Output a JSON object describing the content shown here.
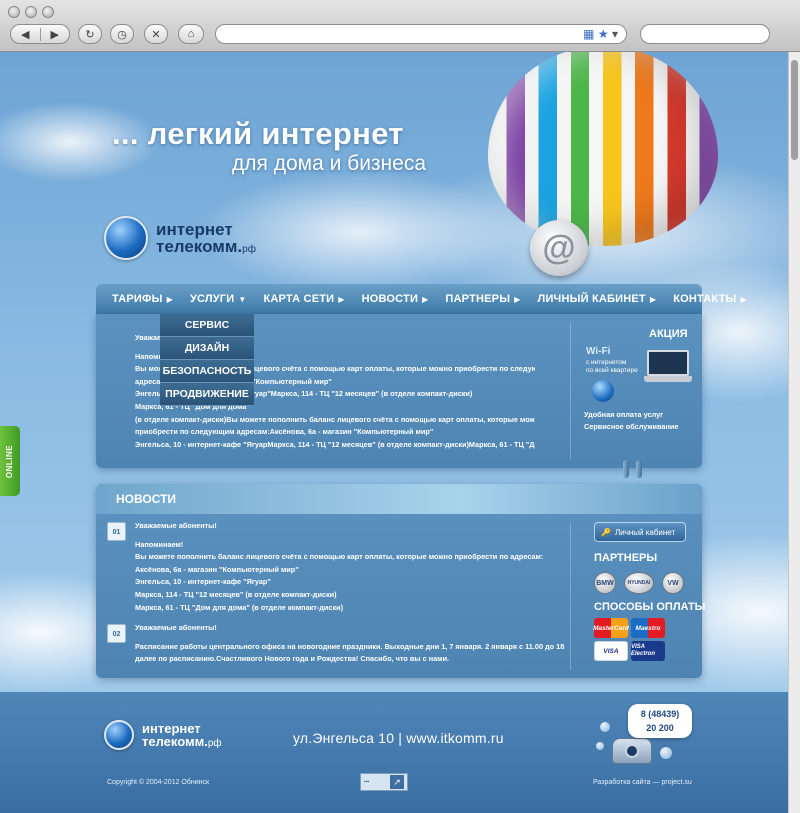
{
  "browser": {
    "back_label": "◀",
    "forward_label": "▶",
    "reload_icon": "reload-icon",
    "history_icon": "clock-icon",
    "stop_icon": "close-icon",
    "home_icon": "home-icon",
    "url": "",
    "search_placeholder": ""
  },
  "hero": {
    "tagline_main": "... легкий интернет",
    "tagline_sub": "для дома и бизнеса"
  },
  "logo": {
    "line1": "интернет",
    "line2": "телекомм.",
    "suffix": "рф"
  },
  "nav": {
    "items": [
      {
        "label": "ТАРИФЫ",
        "arrow": "▶"
      },
      {
        "label": "УСЛУГИ",
        "arrow": "▼"
      },
      {
        "label": "КАРТА СЕТИ",
        "arrow": "▶"
      },
      {
        "label": "НОВОСТИ",
        "arrow": "▶"
      },
      {
        "label": "ПАРТНЕРЫ",
        "arrow": "▶"
      },
      {
        "label": "ЛИЧНЫЙ КАБИНЕТ",
        "arrow": "▶"
      },
      {
        "label": "КОНТАКТЫ",
        "arrow": "▶"
      }
    ],
    "dropdown": [
      "СЕРВИС",
      "ДИЗАЙН",
      "БЕЗОПАСНОСТЬ",
      "ПРОДВИЖЕНИЕ"
    ]
  },
  "announcement": {
    "lines": [
      "Уважаемые абоненты!",
      "Напоминаем!",
      "Вы можете пополнить баланс лицевого счёта с помощью карт оплаты, которые можно приобрести по следующим",
      "адресам:Аксёнова, 6а - магазин \"Компьютерный мир\"",
      "Энгельса, 10 - интернет-кафе \"Ягуар\"Маркса, 114 - ТЦ \"12 месяцев\" (в отделе компакт-диски)",
      "Маркса, 61 - ТЦ \"Дом для дома\"",
      "(в отделе компакт-диски)Вы можете пополнить баланс лицевого счёта с помощью карт оплаты, которые можно",
      "приобрести по следующим адресам:Аксёнова, 6а - магазин \"Компьютерный мир\"",
      "Энгельса, 10 - интернет-кафе \"ЯгуарМаркса, 114 - ТЦ \"12 месяцев\" (в отделе компакт-диски)Маркса, 61 - ТЦ \"Дом"
    ]
  },
  "promo": {
    "title": "АКЦИЯ",
    "wifi": "Wi-Fi",
    "wifi_desc_1": "с интернетом",
    "wifi_desc_2": "по всей квартире",
    "feature_1": "Удобная оплата услуг",
    "feature_2": "Сервисное обслуживание"
  },
  "news": {
    "title": "НОВОСТИ",
    "items": [
      {
        "date": "01",
        "heading": "Уважаемые абоненты!",
        "lines": [
          "Напоминаем!",
          "Вы можете пополнить баланс лицевого счёта с помощью карт оплаты, которые можно приобрести по адресам:",
          "Аксёнова, 6а - магазин \"Компьютерный мир\"",
          "Энгельса, 10 - интернет-кафе \"Ягуар\"",
          "Маркса, 114 - ТЦ \"12 месяцев\" (в отделе компакт-диски)",
          "Маркса, 61 - ТЦ \"Дом для дома\" (в отделе компакт-диски)"
        ]
      },
      {
        "date": "02",
        "heading": "Уважаемые абоненты!",
        "lines": [
          "Расписание работы центрального офиса на новогодние праздники. Выходные дни 1, 7 января. 2 января с 11.00 до 18.00,",
          "далее по расписанию.Счастливого Нового года и Рождества! Спасибо, что вы с нами."
        ]
      }
    ]
  },
  "sidebar": {
    "cabinet_button": "Личный кабинет",
    "partners_title": "ПАРТНЕРЫ",
    "partners": [
      "BMW",
      "HYUNDAI",
      "VW"
    ],
    "payments_title": "СПОСОБЫ ОПЛАТЫ",
    "payments": [
      "MasterCard",
      "Maestro",
      "VISA",
      "VISA Electron"
    ]
  },
  "footer": {
    "address": "ул.Энгельса 10  |  www.itkomm.ru",
    "copyright": "Copyright © 2004-2012 Обнинск",
    "developer": "Разработка сайта — project.su",
    "phone_code": "8 (48439)",
    "phone_number": "20 200"
  },
  "online_tab": "ONLINE",
  "colors": {
    "sky": "#8dbde4",
    "panel": "#5c92bf",
    "nav": "#3d79a8",
    "dropdown": "#2a5478",
    "online": "#4fae2c"
  }
}
